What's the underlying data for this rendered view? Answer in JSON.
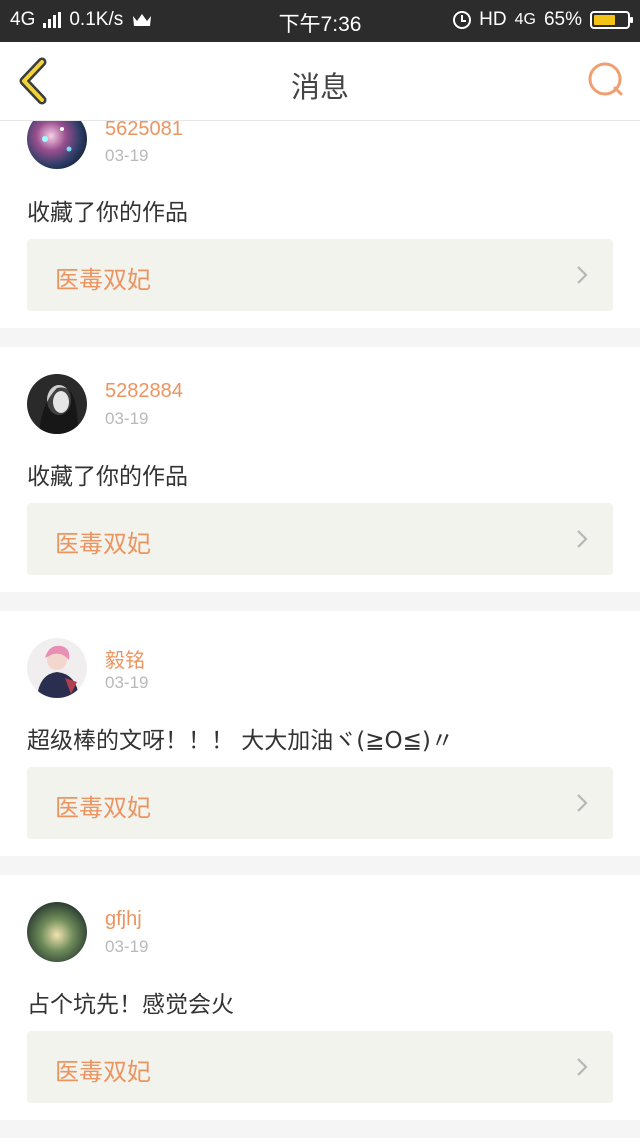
{
  "status_bar": {
    "network": "4G",
    "speed": "0.1K/s",
    "time": "下午7:36",
    "hd": "HD",
    "net_right": "4G",
    "battery": "65%",
    "battery_level": 0.65,
    "battery_color": "#f3c318"
  },
  "nav": {
    "title": "消息",
    "back_icon": "back-chevron-icon",
    "search_icon": "search-icon",
    "accent": "#ec9460"
  },
  "messages": [
    {
      "username": "5625081",
      "date": "03-19",
      "text": "收藏了你的作品",
      "work": "医毒双妃"
    },
    {
      "username": "5282884",
      "date": "03-19",
      "text": "收藏了你的作品",
      "work": "医毒双妃"
    },
    {
      "username": "毅铭",
      "date": "03-19",
      "text": "超级棒的文呀！！！ 大大加油ヾ(≧O≦)〃",
      "work": "医毒双妃"
    },
    {
      "username": "gfjhj",
      "date": "03-19",
      "text": "占个坑先！感觉会火",
      "work": "医毒双妃"
    }
  ]
}
